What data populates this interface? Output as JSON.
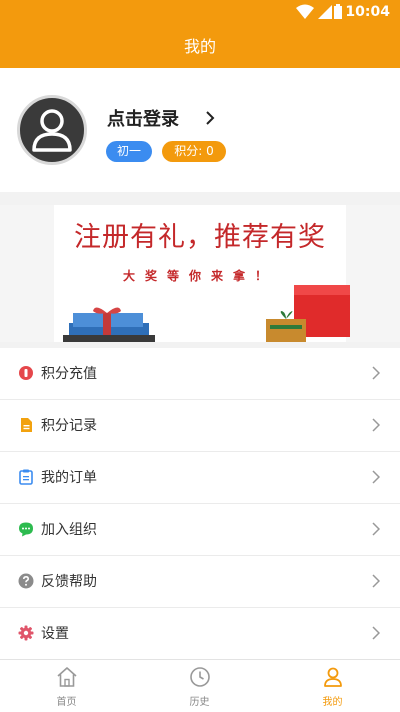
{
  "status_bar": {
    "time": "10:04"
  },
  "header": {
    "title": "我的"
  },
  "profile": {
    "login_text": "点击登录",
    "level_badge": "初一",
    "points_badge": "积分: 0"
  },
  "banner": {
    "title": "注册有礼，推荐有奖",
    "subtitle": "大奖等你来拿！"
  },
  "menu": {
    "items": [
      {
        "label": "积分充值",
        "icon": "coin-icon",
        "color": "#e5474b"
      },
      {
        "label": "积分记录",
        "icon": "document-icon",
        "color": "#f2a20f"
      },
      {
        "label": "我的订单",
        "icon": "order-list-icon",
        "color": "#3b8cf0"
      },
      {
        "label": "加入组织",
        "icon": "chat-bubble-icon",
        "color": "#2dbb4f"
      },
      {
        "label": "反馈帮助",
        "icon": "help-icon",
        "color": "#8b8b8b"
      },
      {
        "label": "设置",
        "icon": "gear-icon",
        "color": "#e0556a"
      }
    ]
  },
  "tabs": [
    {
      "label": "首页",
      "icon": "home-icon",
      "active": false
    },
    {
      "label": "历史",
      "icon": "clock-icon",
      "active": false
    },
    {
      "label": "我的",
      "icon": "user-icon",
      "active": true
    }
  ],
  "colors": {
    "accent": "#f39a0d",
    "level_badge": "#3b8cf0",
    "banner_red": "#c4282a"
  }
}
